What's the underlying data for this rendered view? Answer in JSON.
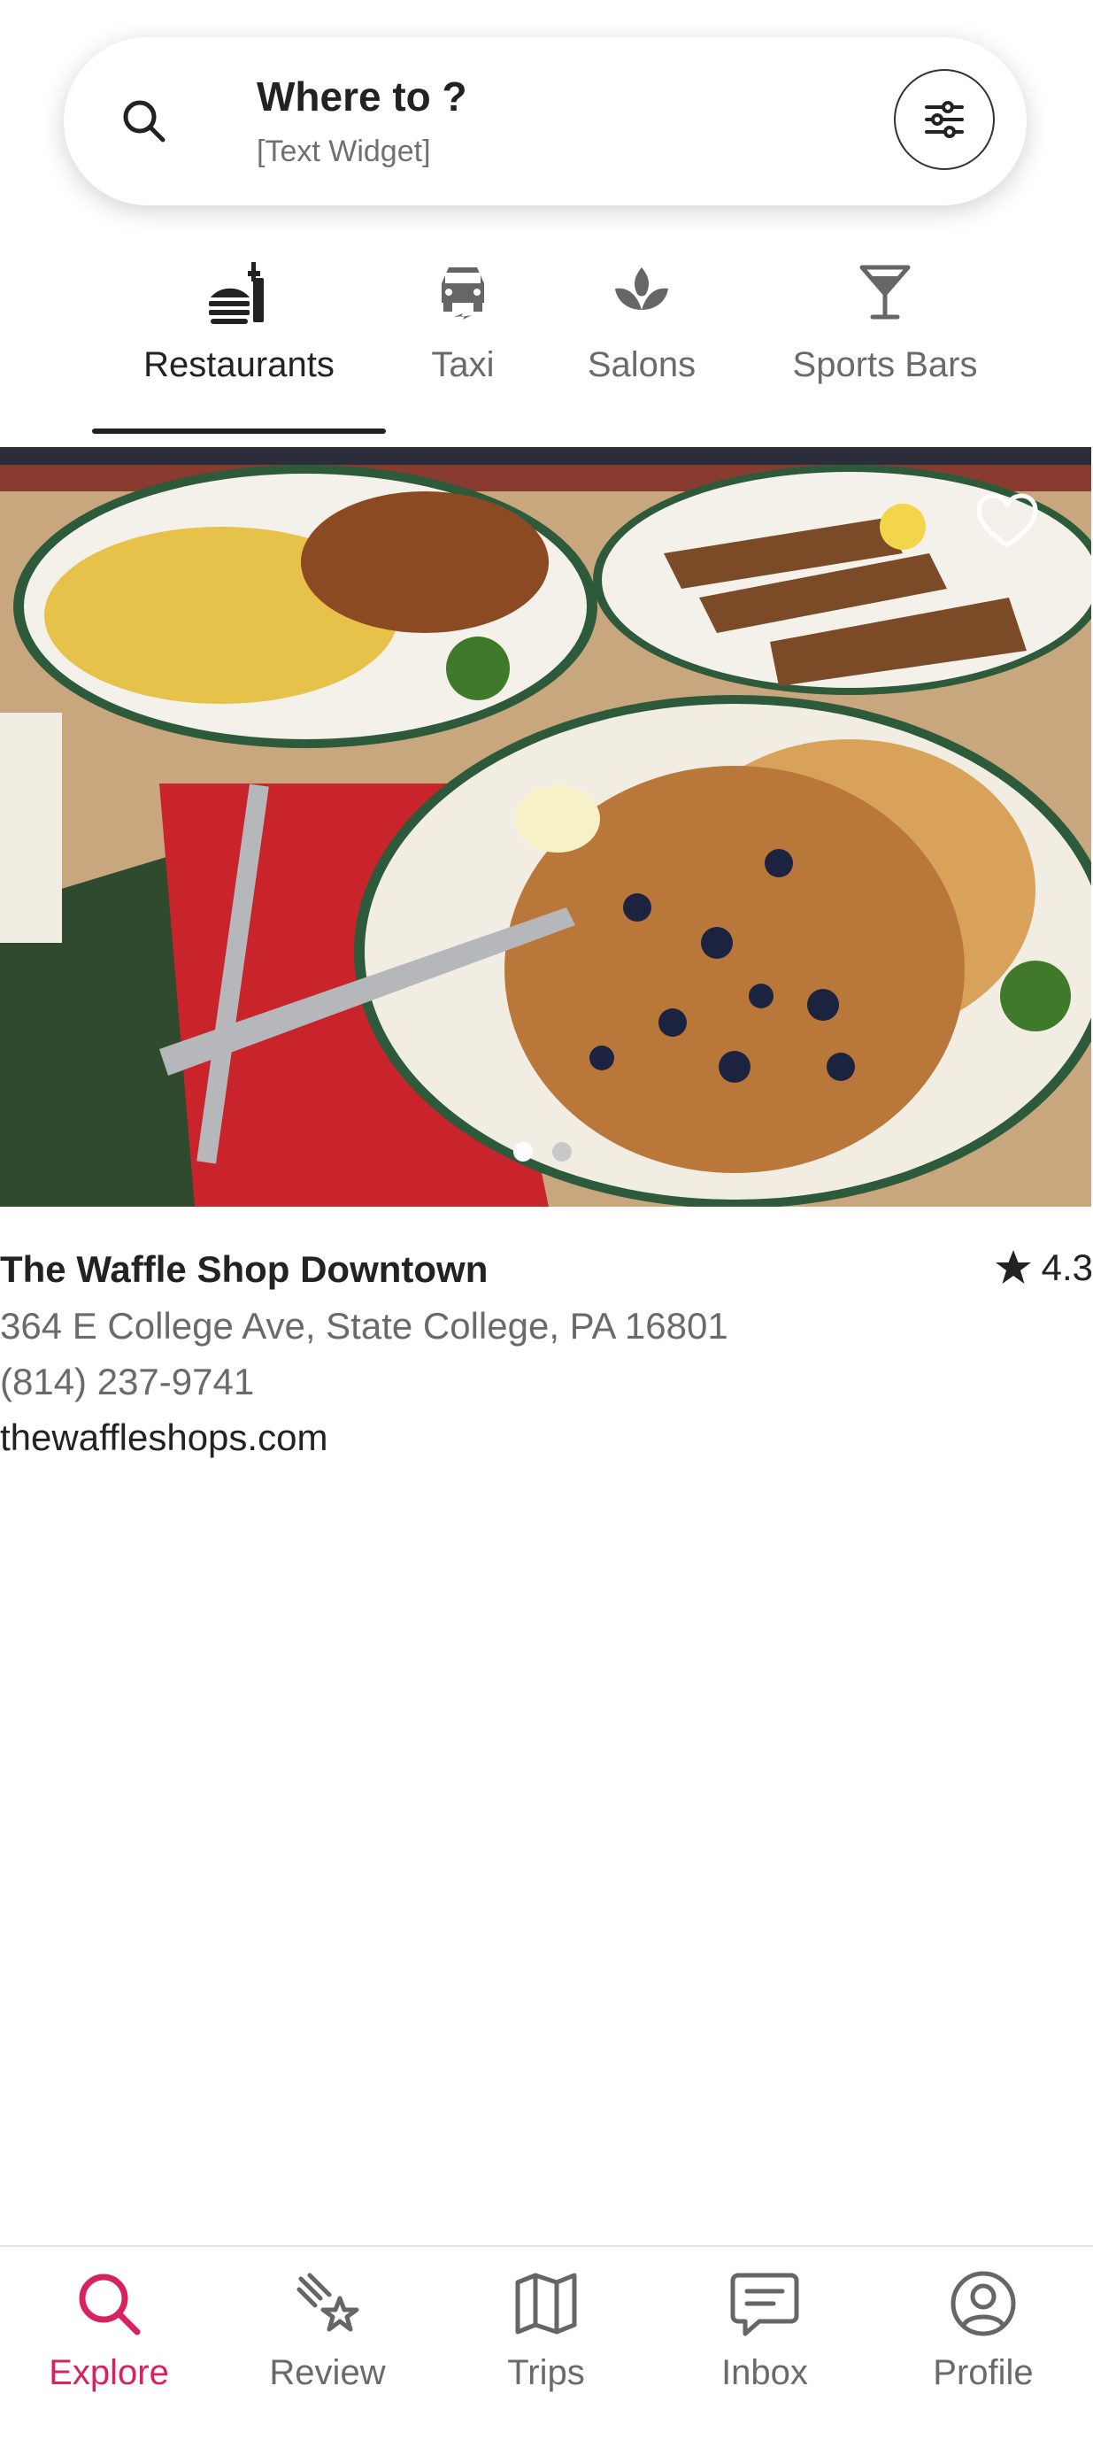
{
  "search": {
    "title": "Where to ?",
    "subtitle": "[Text Widget]",
    "icon": "search-icon",
    "filter_icon": "sliders-icon"
  },
  "categories": [
    {
      "label": "Restaurants",
      "icon": "food-icon",
      "active": true
    },
    {
      "label": "Taxi",
      "icon": "taxi-icon",
      "active": false
    },
    {
      "label": "Salons",
      "icon": "salon-icon",
      "active": false
    },
    {
      "label": "Sports Bars",
      "icon": "cocktail-icon",
      "active": false
    }
  ],
  "listing": {
    "name": "The Waffle Shop Downtown",
    "rating": "4.3",
    "address": "364 E College Ave, State College, PA 16801",
    "phone": "(814) 237-9741",
    "website": "thewaffleshops.com",
    "photo_count": 2,
    "photo_index": 1,
    "favorite_icon": "heart-icon"
  },
  "bottom_nav": [
    {
      "label": "Explore",
      "icon": "search-icon",
      "active": true
    },
    {
      "label": "Review",
      "icon": "review-icon",
      "active": false
    },
    {
      "label": "Trips",
      "icon": "map-icon",
      "active": false
    },
    {
      "label": "Inbox",
      "icon": "message-icon",
      "active": false
    },
    {
      "label": "Profile",
      "icon": "profile-icon",
      "active": false
    }
  ],
  "colors": {
    "accent": "#d6235f",
    "text": "#222222",
    "muted": "#6a6a6a"
  }
}
